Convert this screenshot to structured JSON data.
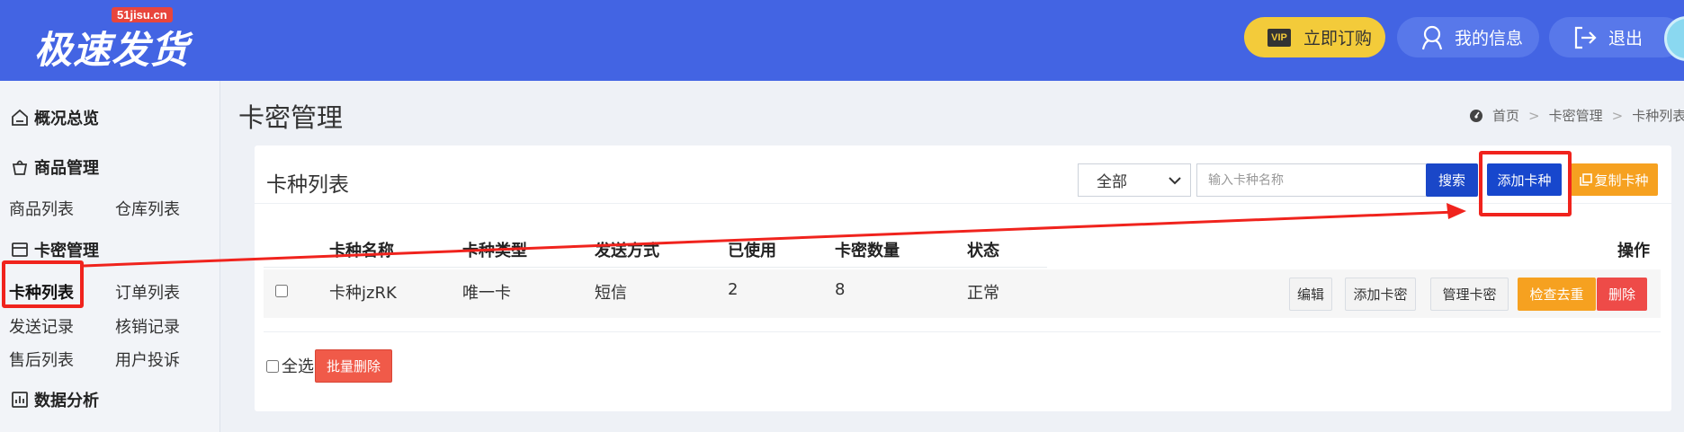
{
  "header": {
    "logo": "极速发货",
    "logo_badge": "51jisu.cn",
    "vip_tag": "VIP",
    "subscribe": "立即订购",
    "my_info": "我的信息",
    "logout": "退出"
  },
  "sidebar": {
    "overview": "概况总览",
    "goods": {
      "title": "商品管理",
      "items": [
        "商品列表",
        "仓库列表"
      ]
    },
    "cards": {
      "title": "卡密管理",
      "items": [
        "卡种列表",
        "订单列表",
        "发送记录",
        "核销记录",
        "售后列表",
        "用户投诉"
      ]
    },
    "analytics": "数据分析"
  },
  "main": {
    "title": "卡密管理",
    "breadcrumb": [
      "首页",
      "卡密管理",
      "卡种列表"
    ],
    "card_title": "卡种列表",
    "filter_selected": "全部",
    "search_placeholder": "输入卡种名称",
    "search_button": "搜索",
    "add_button": "添加卡种",
    "copy_button": "复制卡种",
    "columns": [
      "卡种名称",
      "卡种类型",
      "发送方式",
      "已使用",
      "卡密数量",
      "状态",
      "操作"
    ],
    "rows": [
      {
        "name": "卡种jzRK",
        "type": "唯一卡",
        "send": "短信",
        "used": "2",
        "count": "8",
        "status": "正常"
      }
    ],
    "actions": [
      "编辑",
      "添加卡密",
      "管理卡密",
      "检查去重",
      "删除"
    ],
    "select_all": "全选",
    "batch_delete": "批量删除"
  },
  "colors": {
    "header_bg": "#4364e3",
    "primary": "#1747cd",
    "warning": "#f6a120",
    "danger": "#ee4b48",
    "annotation": "#f0231d"
  }
}
